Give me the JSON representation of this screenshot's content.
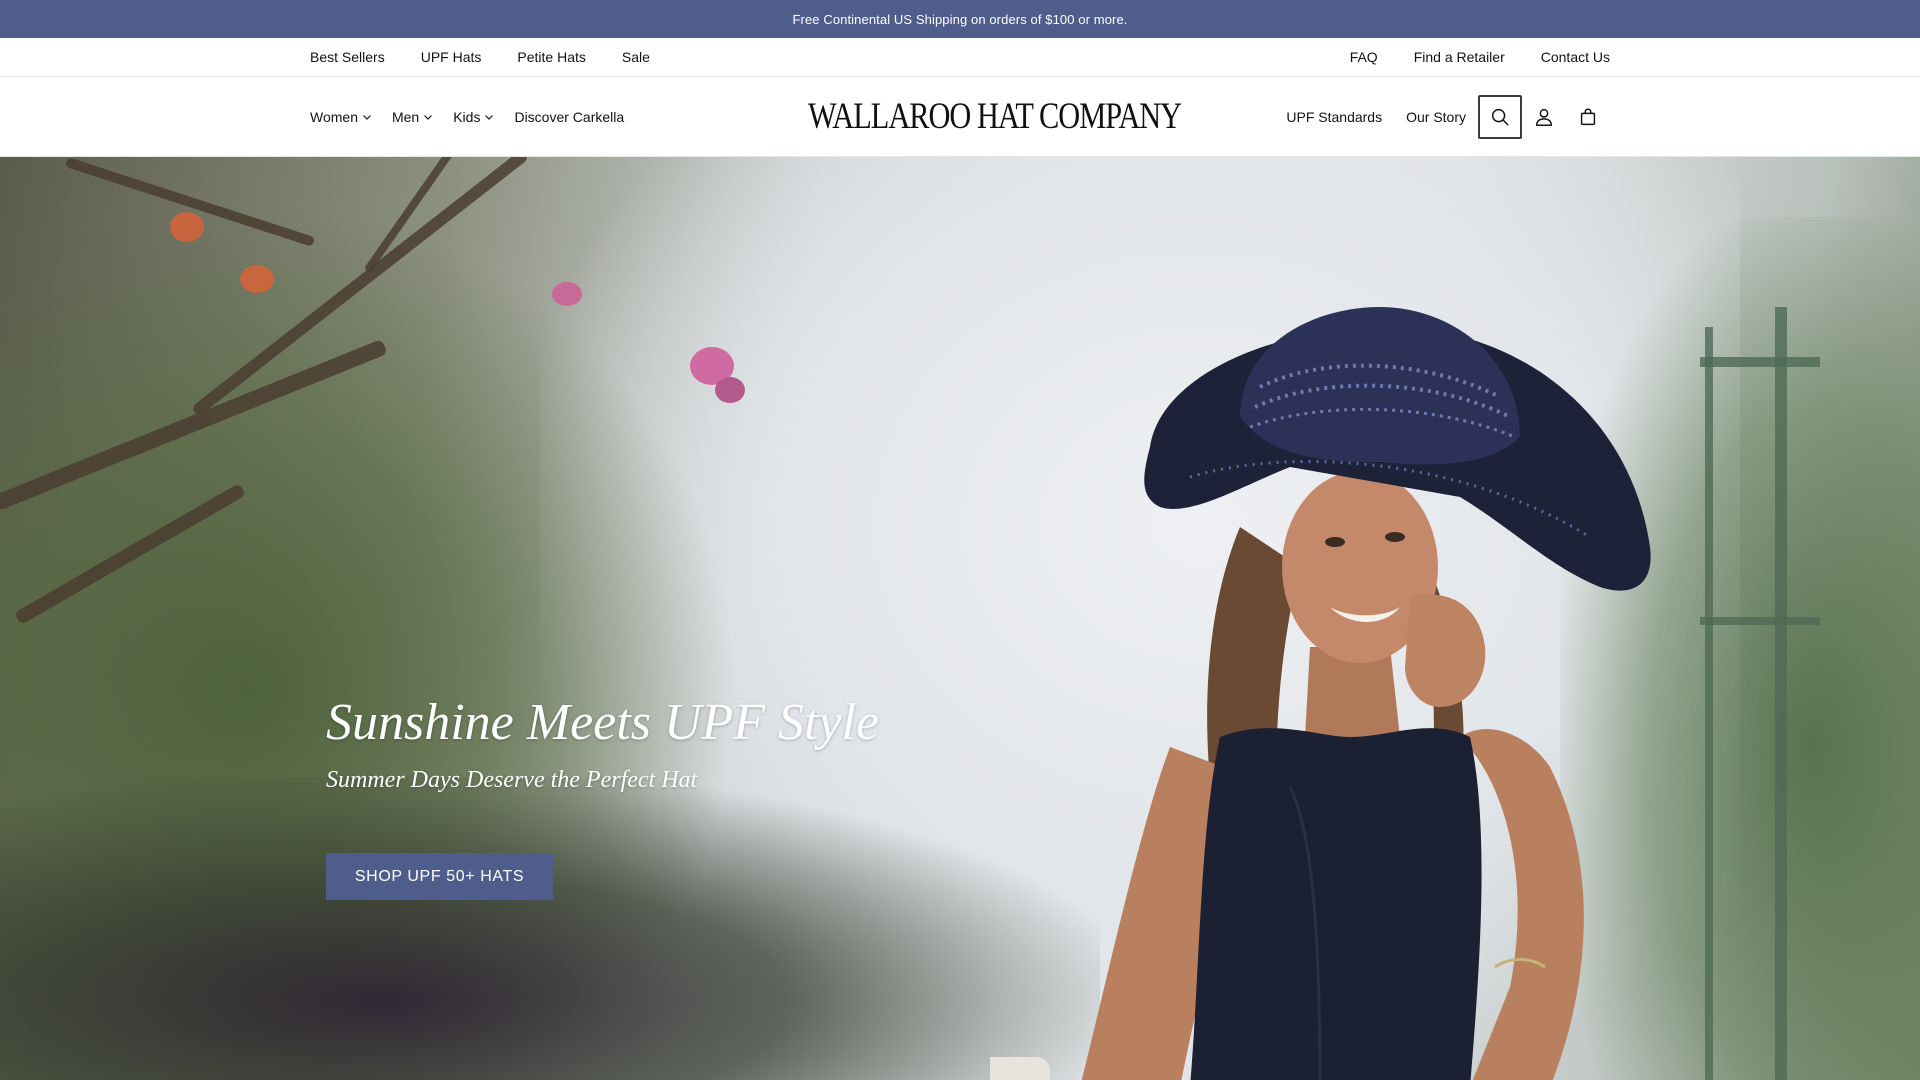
{
  "announcement": {
    "text": "Free Continental US Shipping on orders of $100 or more."
  },
  "utility_nav": {
    "left": [
      "Best Sellers",
      "UPF Hats",
      "Petite Hats",
      "Sale"
    ],
    "right": [
      "FAQ",
      "Find a Retailer",
      "Contact Us"
    ]
  },
  "main_nav": {
    "items": [
      {
        "label": "Women",
        "has_dropdown": true
      },
      {
        "label": "Men",
        "has_dropdown": true
      },
      {
        "label": "Kids",
        "has_dropdown": true
      },
      {
        "label": "Discover Carkella",
        "has_dropdown": false
      }
    ]
  },
  "logo": {
    "text": "WALLAROO HAT COMPANY"
  },
  "right_nav": {
    "links": [
      "UPF Standards",
      "Our Story"
    ],
    "icons": [
      "search-icon",
      "account-icon",
      "cart-icon"
    ],
    "active_icon": "search-icon"
  },
  "hero": {
    "title": "Sunshine Meets UPF Style",
    "subtitle": "Summer Days Deserve the Perfect Hat",
    "cta_label": "SHOP UPF 50+ HATS"
  },
  "colors": {
    "brand_blue": "#4f5d8c",
    "text": "#121212",
    "white": "#ffffff"
  }
}
